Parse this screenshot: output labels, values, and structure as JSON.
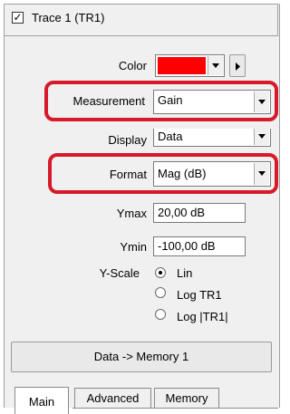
{
  "trace": {
    "checked_mark": "✓",
    "title": "Trace 1 (TR1)"
  },
  "color_row": {
    "label": "Color",
    "swatch": "#ff0000"
  },
  "measurement": {
    "label": "Measurement",
    "value": "Gain"
  },
  "display": {
    "label": "Display",
    "value": "Data"
  },
  "format": {
    "label": "Format",
    "value": "Mag (dB)"
  },
  "ymax": {
    "label": "Ymax",
    "value": "20,00 dB"
  },
  "ymin": {
    "label": "Ymin",
    "value": "-100,00 dB"
  },
  "yscale": {
    "label": "Y-Scale",
    "options": [
      {
        "label": "Lin",
        "selected": true
      },
      {
        "label": "Log TR1",
        "selected": false
      },
      {
        "label": "Log |TR1|",
        "selected": false
      }
    ]
  },
  "data_memory_button": "Data -> Memory 1",
  "tabs": [
    {
      "label": "Main",
      "active": true
    },
    {
      "label": "Advanced",
      "active": false
    },
    {
      "label": "Memory",
      "active": false
    }
  ],
  "colors": {
    "highlight": "#d71a2a",
    "panel": "#f0f0f0"
  },
  "icons": [
    "checkbox-checked",
    "dropdown-arrow",
    "right-arrow"
  ]
}
